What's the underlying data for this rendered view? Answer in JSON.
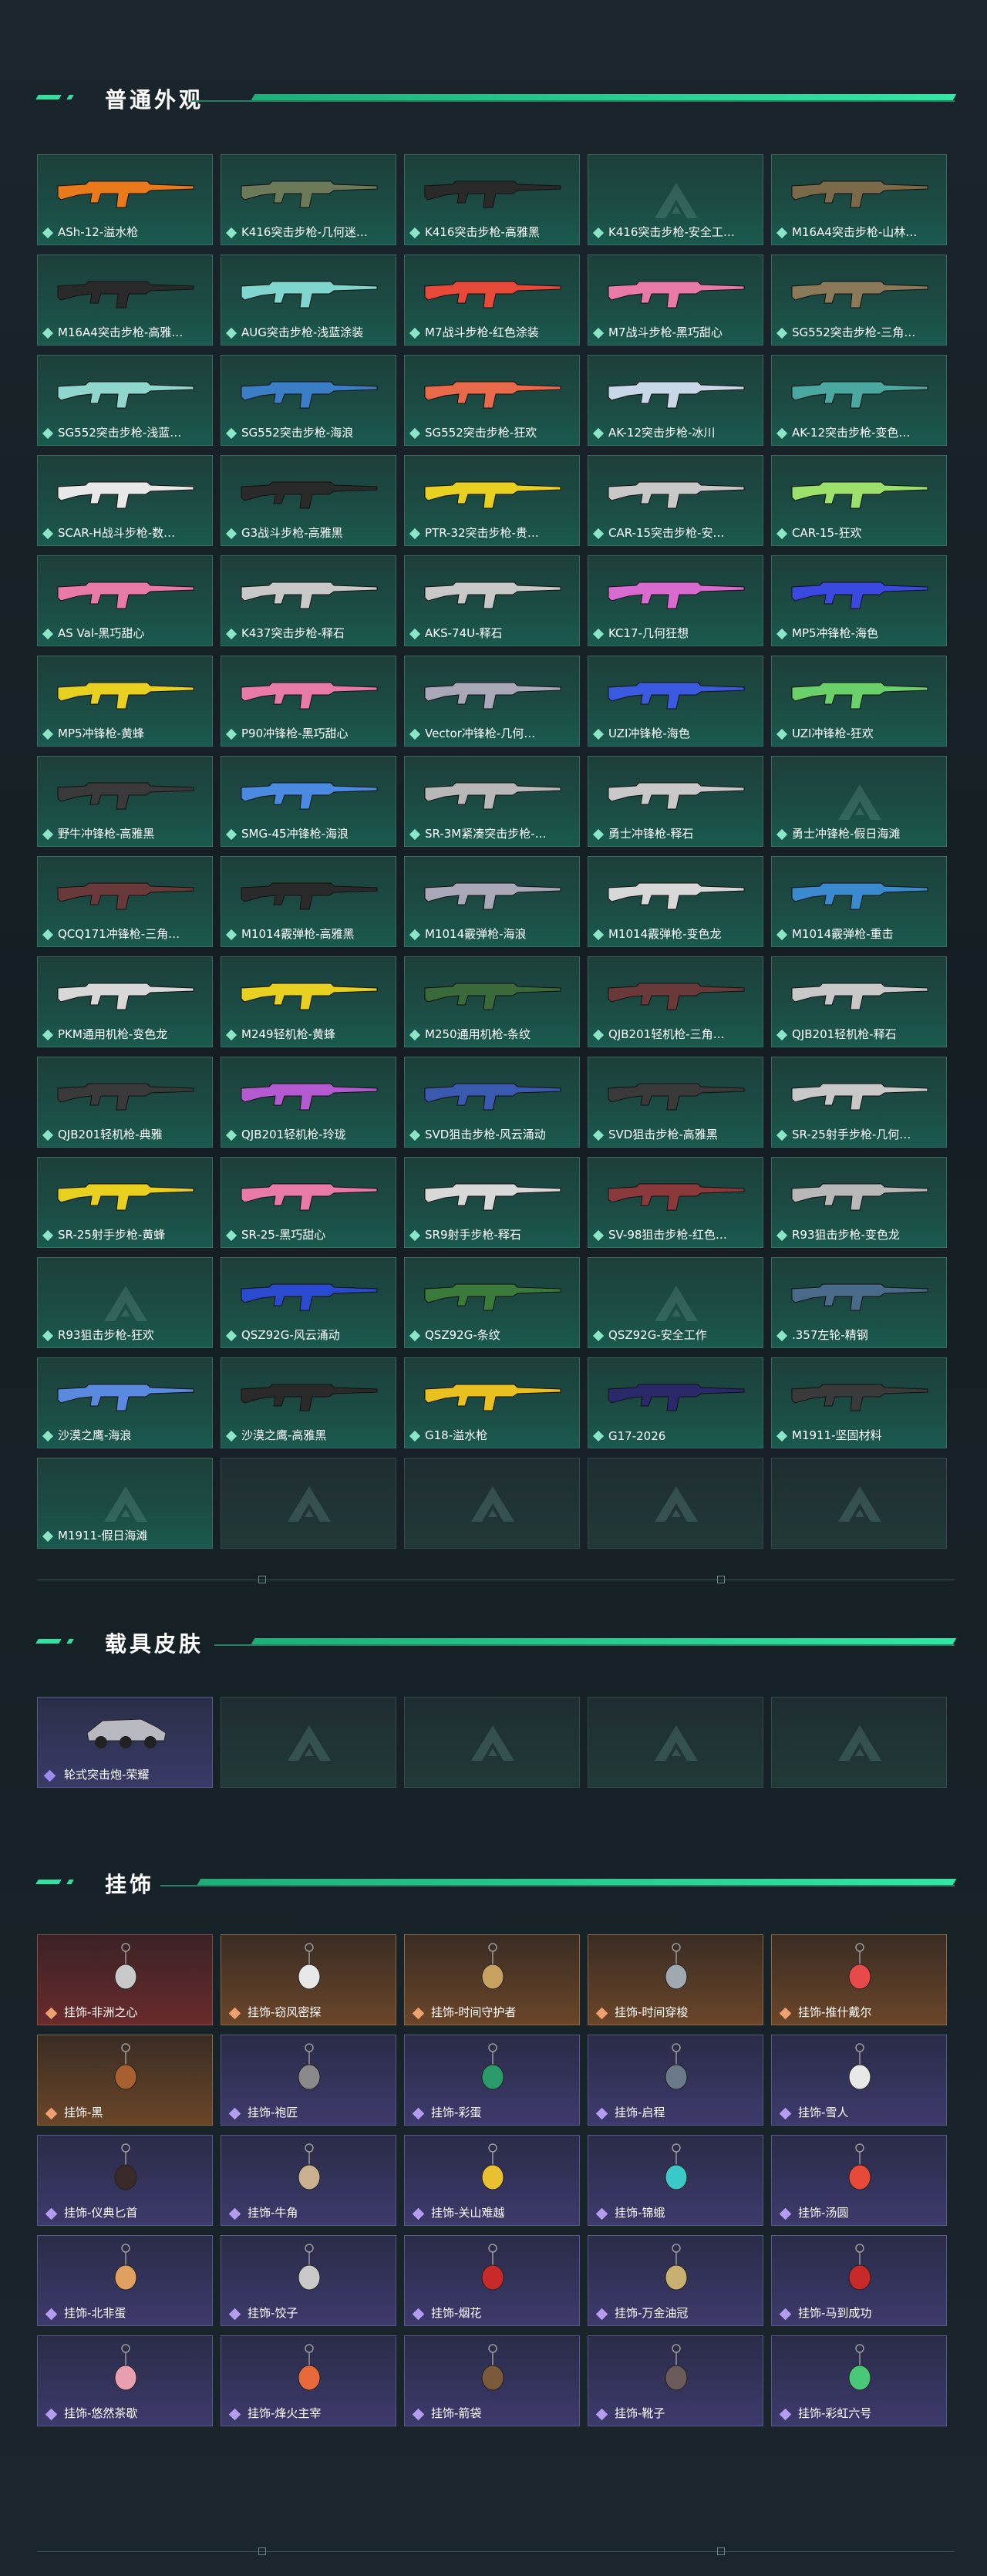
{
  "sections": {
    "weapons_title": "普通外观",
    "vehicles_title": "载具皮肤",
    "charms_title": "挂饰"
  },
  "weapons": [
    "ASh-12-溢水枪",
    "K416突击步枪-几何迷…",
    "K416突击步枪-高雅黑",
    "K416突击步枪-安全工…",
    "M16A4突击步枪-山林…",
    "M16A4突击步枪-高雅…",
    "AUG突击步枪-浅蓝涂装",
    "M7战斗步枪-红色涂装",
    "M7战斗步枪-黑巧甜心",
    "SG552突击步枪-三角…",
    "SG552突击步枪-浅蓝…",
    "SG552突击步枪-海浪",
    "SG552突击步枪-狂欢",
    "AK-12突击步枪-冰川",
    "AK-12突击步枪-变色…",
    "SCAR-H战斗步枪-数…",
    "G3战斗步枪-高雅黑",
    "PTR-32突击步枪-贵…",
    "CAR-15突击步枪-安…",
    "CAR-15-狂欢",
    "AS Val-黑巧甜心",
    "K437突击步枪-释石",
    "AKS-74U-释石",
    "KC17-几何狂想",
    "MP5冲锋枪-海色",
    "MP5冲锋枪-黄蜂",
    "P90冲锋枪-黑巧甜心",
    "Vector冲锋枪-几何…",
    "UZI冲锋枪-海色",
    "UZI冲锋枪-狂欢",
    "野牛冲锋枪-高雅黑",
    "SMG-45冲锋枪-海浪",
    "SR-3M紧凑突击步枪-…",
    "勇士冲锋枪-释石",
    "勇士冲锋枪-假日海滩",
    "QCQ171冲锋枪-三角…",
    "M1014霰弹枪-高雅黑",
    "M1014霰弹枪-海浪",
    "M1014霰弹枪-变色龙",
    "M1014霰弹枪-重击",
    "PKM通用机枪-变色龙",
    "M249轻机枪-黄蜂",
    "M250通用机枪-条纹",
    "QJB201轻机枪-三角…",
    "QJB201轻机枪-释石",
    "QJB201轻机枪-典雅",
    "QJB201轻机枪-玲珑",
    "SVD狙击步枪-风云涌动",
    "SVD狙击步枪-高雅黑",
    "SR-25射手步枪-几何…",
    "SR-25射手步枪-黄蜂",
    "SR-25-黑巧甜心",
    "SR9射手步枪-释石",
    "SV-98狙击步枪-红色…",
    "R93狙击步枪-变色龙",
    "R93狙击步枪-狂欢",
    "QSZ92G-风云涌动",
    "QSZ92G-条纹",
    "QSZ92G-安全工作",
    ".357左轮-精钢",
    "沙漠之鹰-海浪",
    "沙漠之鹰-高雅黑",
    "G18-溢水枪",
    "G17-2026",
    "M1911-坚固材料",
    "M1911-假日海滩"
  ],
  "vehicles": [
    "轮式突击炮-荣耀"
  ],
  "charms": [
    "挂饰-非洲之心",
    "挂饰-窃风密探",
    "挂饰-时间守护者",
    "挂饰-时间穿梭",
    "挂饰-推什戴尔",
    "挂饰-黑",
    "挂饰-袍匠",
    "挂饰-彩蛋",
    "挂饰-启程",
    "挂饰-雪人",
    "挂饰-仪典匕首",
    "挂饰-牛角",
    "挂饰-关山难越",
    "挂饰-锦蛾",
    "挂饰-汤圆",
    "挂饰-北非蛋",
    "挂饰-饺子",
    "挂饰-烟花",
    "挂饰-万金油冠",
    "挂饰-马到成功",
    "挂饰-悠然茶歇",
    "挂饰-烽火主宰",
    "挂饰-箭袋",
    "挂饰-靴子",
    "挂饰-彩虹六号"
  ],
  "charm_colors": [
    "red",
    "orange",
    "orange",
    "orange",
    "orange",
    "orange",
    "purple",
    "purple",
    "purple",
    "purple",
    "purple",
    "purple",
    "purple",
    "purple",
    "purple",
    "purple",
    "purple",
    "purple",
    "purple",
    "purple",
    "purple",
    "purple",
    "purple",
    "purple",
    "purple"
  ],
  "weapon_colors": [
    "#e87a1c",
    "#6c7a5a",
    "#2a2a2a",
    "",
    "#7a6a4a",
    "#2a2a2a",
    "#7fd6cf",
    "#e84a3a",
    "#e87aa8",
    "#8a7a5a",
    "#8fd6cf",
    "#3a7fc6",
    "#e86a4a",
    "#c8d8e8",
    "#4aa8a0",
    "#e8e8e8",
    "#2a2a2a",
    "#e8d020",
    "#c8c8c8",
    "#9ae06a",
    "#e87aa8",
    "#c8c8c8",
    "#c8c8c8",
    "#d86ad0",
    "#3a4ae0",
    "#e8d020",
    "#e87aa8",
    "#a8a8b8",
    "#3a5ae0",
    "#6ad06a",
    "#3a3a3a",
    "#4a8ae0",
    "#b8b8b8",
    "#c8c8c8",
    "",
    "#6a3a3a",
    "#2a2a2a",
    "#a8a8b8",
    "#d8d8d8",
    "#3a8ad0",
    "#d8d8d8",
    "#e8d020",
    "#3a6a3a",
    "#6a3a3a",
    "#c8c8c8",
    "#3a3a3a",
    "#b45ad0",
    "#3a5ab0",
    "#3a3a3a",
    "#c8c8c8",
    "#e8d020",
    "#e87aa8",
    "#d8d8d8",
    "#8a3a3a",
    "#b8b8b8",
    "",
    "#2a4ad0",
    "#3a7a3a",
    "",
    "#4a6a8a",
    "#5a8ae0",
    "#2a2a2a",
    "#e8c020",
    "#2a2a6a",
    "#3a3a3a",
    ""
  ]
}
